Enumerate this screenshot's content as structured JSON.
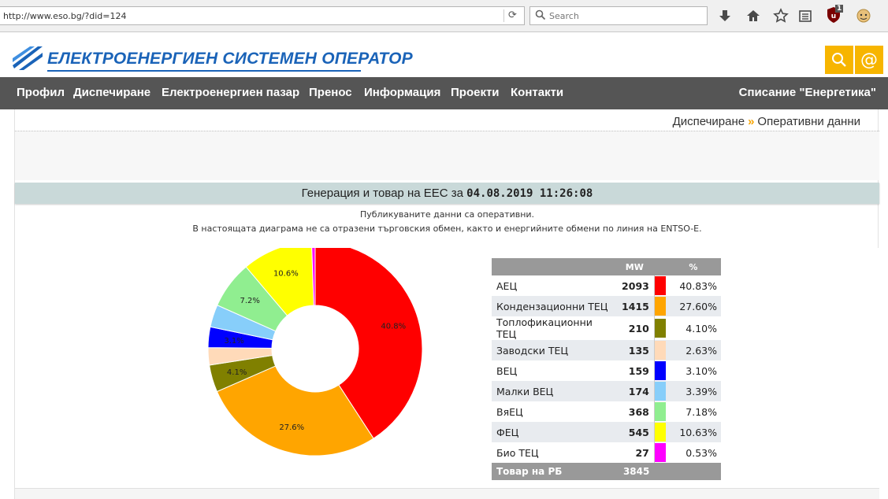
{
  "browser": {
    "url": "http://www.eso.bg/?did=124",
    "search_placeholder": "Search",
    "adblock_count": "1"
  },
  "site": {
    "logo_text": "ЕЛЕКТРОЕНЕРГИЕН СИСТЕМЕН ОПЕРАТОР",
    "nav": [
      "Профил",
      "Диспечиране",
      "Електроенергиен пазар",
      "Пренос",
      "Информация",
      "Проекти",
      "Контакти"
    ],
    "nav_right": "Списание \"Енергетика\"",
    "breadcrumb": [
      "Диспечиране",
      "Оперативни данни"
    ],
    "breadcrumb_sep": "»"
  },
  "report": {
    "title_prefix": "Генерация и товар на ЕЕС за",
    "timestamp": "04.08.2019 11:26:08",
    "note1": "Публикуваните данни са оперативни.",
    "note2": "В настоящата диаграма не са отразени търговския обмен, както и енергийните обмени по линия на ENTSO-E.",
    "col_mw": "MW",
    "col_pct": "%",
    "total_label": "Товар на РБ",
    "total_mw": "3845"
  },
  "chart_data": {
    "type": "pie",
    "labels": [
      "АЕЦ",
      "Кондензационни ТЕЦ",
      "Топлофикационни ТЕЦ",
      "Заводски ТЕЦ",
      "ВЕЦ",
      "Малки ВЕЦ",
      "ВяЕЦ",
      "ФЕЦ",
      "Био ТЕЦ"
    ],
    "mw": [
      "2093",
      "1415",
      "210",
      "135",
      "159",
      "174",
      "368",
      "545",
      "27"
    ],
    "percent": [
      "40.83%",
      "27.60%",
      "4.10%",
      "2.63%",
      "3.10%",
      "3.39%",
      "7.18%",
      "10.63%",
      "0.53%"
    ],
    "values": [
      40.83,
      27.6,
      4.1,
      2.63,
      3.1,
      3.39,
      7.18,
      10.63,
      0.53
    ],
    "slice_labels": [
      "40.8%",
      "27.6%",
      "4.1%",
      "",
      "3.1%",
      "",
      "7.2%",
      "10.6%",
      ""
    ],
    "colors": [
      "#ff0000",
      "#ffa500",
      "#808000",
      "#ffdab9",
      "#0000ff",
      "#87cefa",
      "#90ee90",
      "#ffff00",
      "#ff00ff"
    ],
    "donut": true
  }
}
